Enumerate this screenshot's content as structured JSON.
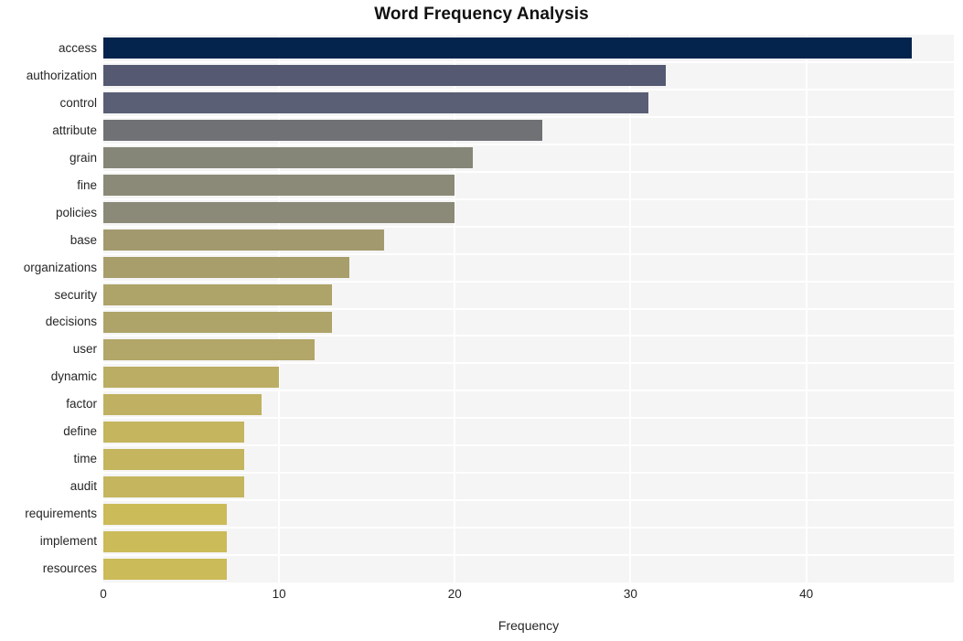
{
  "chart_data": {
    "type": "bar",
    "orientation": "horizontal",
    "title": "Word Frequency Analysis",
    "xlabel": "Frequency",
    "ylabel": "",
    "xlim": [
      0,
      48.4
    ],
    "ylim": [
      0,
      20
    ],
    "grid": true,
    "grid_axis": "x",
    "legend": null,
    "categories": [
      "access",
      "authorization",
      "control",
      "attribute",
      "grain",
      "fine",
      "policies",
      "base",
      "organizations",
      "security",
      "decisions",
      "user",
      "dynamic",
      "factor",
      "define",
      "time",
      "audit",
      "requirements",
      "implement",
      "resources"
    ],
    "values": [
      46,
      32,
      31,
      25,
      21,
      20,
      20,
      16,
      14,
      13,
      13,
      12,
      10,
      9,
      8,
      8,
      8,
      7,
      7,
      7
    ],
    "bar_colors": [
      "#04234d",
      "#555a72",
      "#5a5f76",
      "#6f7175",
      "#868678",
      "#8b8a78",
      "#8b8a78",
      "#a29a6e",
      "#a89e6b",
      "#aea369",
      "#aea369",
      "#b2a668",
      "#bbad63",
      "#bfb161",
      "#c4b55e",
      "#c4b55e",
      "#c4b55e",
      "#cbbb59",
      "#cbbb59",
      "#cbbb59"
    ],
    "xticks": [
      0,
      10,
      20,
      30,
      40
    ],
    "xtick_labels": [
      "0",
      "10",
      "20",
      "30",
      "40"
    ],
    "plot_background": "#f5f5f5",
    "figure_background": "#ffffff",
    "gridline_color": "#ffffff",
    "tick_label_color": "#262626",
    "title_color": "#111111"
  }
}
